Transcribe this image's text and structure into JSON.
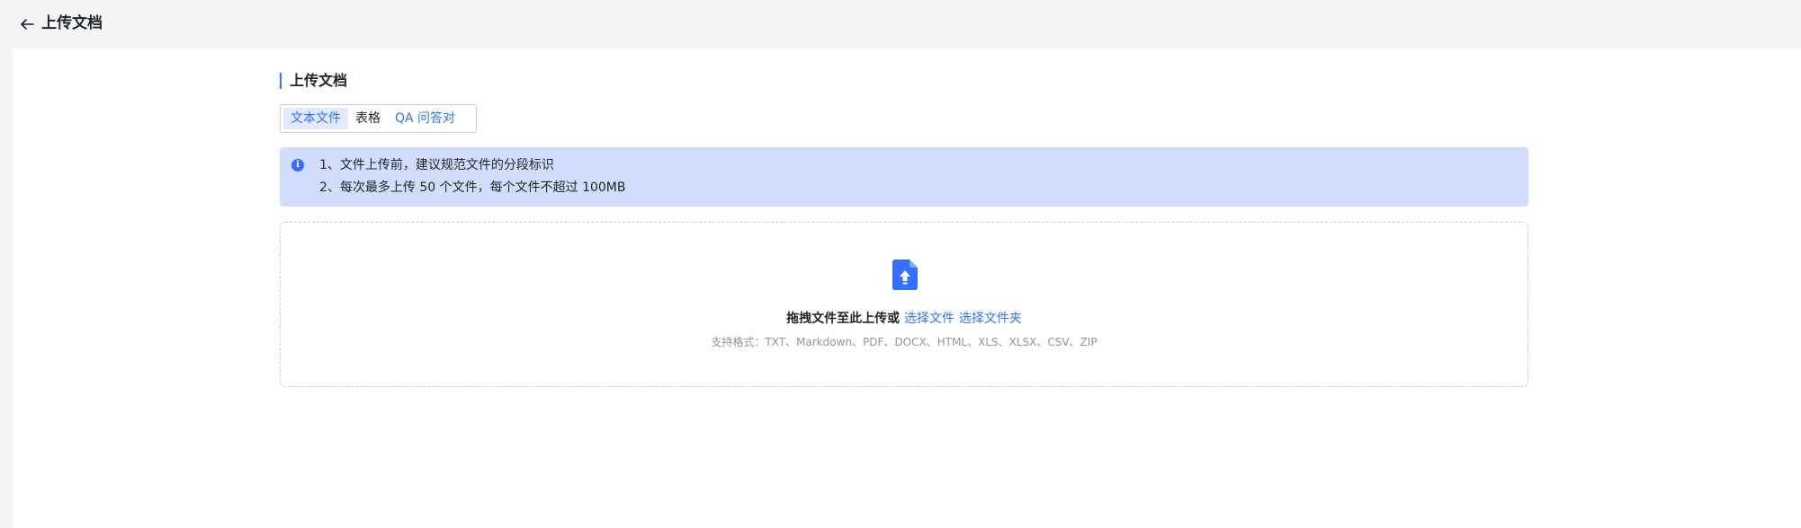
{
  "header": {
    "back_icon": "arrow-left-icon",
    "title": "上传文档"
  },
  "section": {
    "title": "上传文档"
  },
  "tabs": [
    {
      "label": "文本文件",
      "active": true
    },
    {
      "label": "表格",
      "active": false
    },
    {
      "label": "QA 问答对",
      "active": false
    }
  ],
  "notice": {
    "icon": "info-icon",
    "lines": [
      "1、文件上传前，建议规范文件的分段标识",
      "2、每次最多上传 50 个文件，每个文件不超过 100MB"
    ]
  },
  "upload": {
    "icon": "file-upload-icon",
    "prompt": "拖拽文件至此上传或",
    "select_file": "选择文件",
    "select_folder": "选择文件夹",
    "formats": "支持格式：TXT、Markdown、PDF、DOCX、HTML、XLS、XLSX、CSV、ZIP"
  },
  "colors": {
    "accent": "#3370ff",
    "notice_bg": "#d2ddfd",
    "page_bg": "#f3f4f6"
  }
}
